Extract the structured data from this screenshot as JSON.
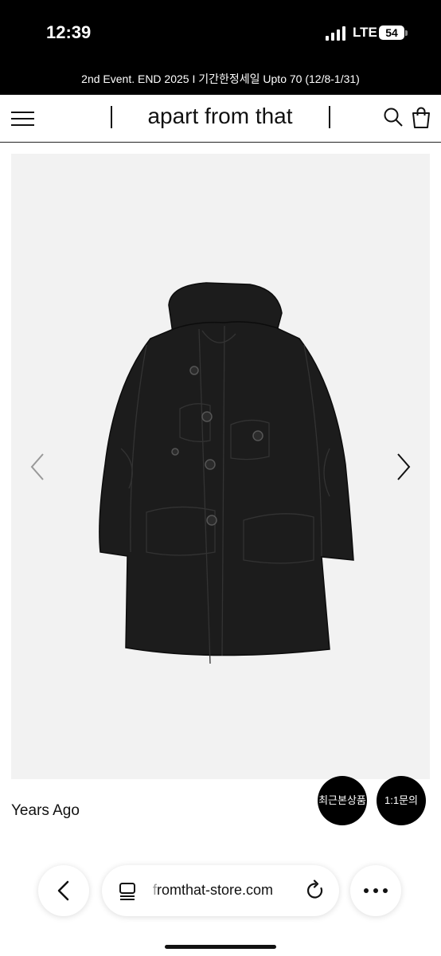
{
  "status_bar": {
    "time": "12:39",
    "network": "LTE",
    "battery": "54"
  },
  "promo_banner": {
    "text": "2nd Event. END 2025 I 기간한정세일 Upto 70 (12/8-1/31)"
  },
  "header": {
    "logo": "apart from that",
    "icons": [
      "menu-icon",
      "search-icon",
      "shopping-bag-icon"
    ]
  },
  "gallery": {
    "icons": [
      "chevron-left-icon",
      "chevron-right-icon"
    ]
  },
  "product": {
    "name": "Years Ago"
  },
  "floating_buttons": {
    "recent": "최근본상품",
    "inquiry": "1:1문의"
  },
  "browser": {
    "url_dim": "f",
    "url_rest": "romthat-store.com",
    "icons": [
      "back-arrow-icon",
      "tabs-icon",
      "reload-icon",
      "more-icon"
    ]
  },
  "colors": {
    "background": "#ffffff",
    "banner": "#000000",
    "gallery_bg": "#f2f2f2",
    "accent": "#000000"
  }
}
